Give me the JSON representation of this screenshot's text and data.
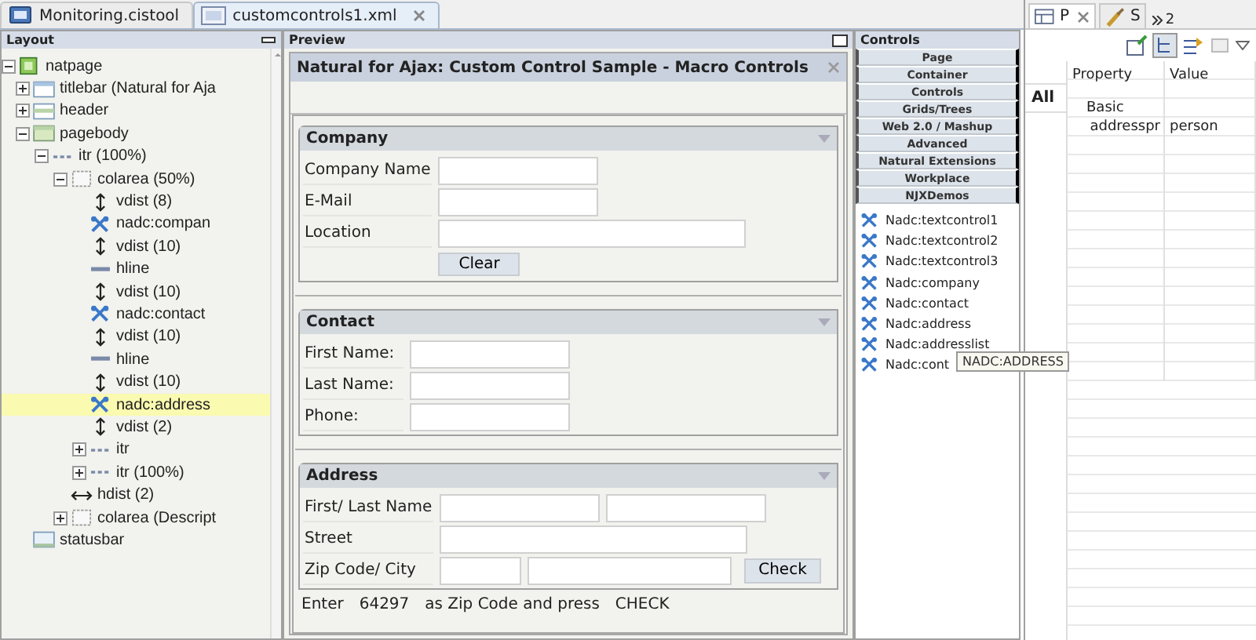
{
  "editor_tabs": [
    {
      "label": "Monitoring.cistool",
      "kind": "monitor",
      "selected": false,
      "closable": false
    },
    {
      "label": "customcontrols1.xml",
      "kind": "xml",
      "selected": true,
      "closable": true
    }
  ],
  "layout": {
    "title": "Layout",
    "tree": [
      {
        "label": "natpage",
        "kind": "page",
        "expanded": true,
        "selected": false,
        "children": [
          {
            "label": "titlebar (Natural for Aja",
            "kind": "window",
            "expanded": false,
            "selected": false
          },
          {
            "label": "header",
            "kind": "panel",
            "expanded": false,
            "selected": false
          },
          {
            "label": "pagebody",
            "kind": "body",
            "expanded": true,
            "selected": false,
            "children": [
              {
                "label": "itr (100%)",
                "kind": "row",
                "expanded": true,
                "selected": false,
                "children": [
                  {
                    "label": "colarea (50%)",
                    "kind": "area",
                    "expanded": true,
                    "selected": false,
                    "children": [
                      {
                        "label": "vdist (8)",
                        "kind": "vdist",
                        "selected": false
                      },
                      {
                        "label": "nadc:compan",
                        "kind": "tools",
                        "selected": false
                      },
                      {
                        "label": "vdist (10)",
                        "kind": "vdist",
                        "selected": false
                      },
                      {
                        "label": "hline",
                        "kind": "hline",
                        "selected": false
                      },
                      {
                        "label": "vdist (10)",
                        "kind": "vdist",
                        "selected": false
                      },
                      {
                        "label": "nadc:contact",
                        "kind": "tools",
                        "selected": false
                      },
                      {
                        "label": "vdist (10)",
                        "kind": "vdist",
                        "selected": false
                      },
                      {
                        "label": "hline",
                        "kind": "hline",
                        "selected": false
                      },
                      {
                        "label": "vdist (10)",
                        "kind": "vdist",
                        "selected": false
                      },
                      {
                        "label": "nadc:address",
                        "kind": "tools",
                        "selected": true
                      },
                      {
                        "label": "vdist (2)",
                        "kind": "vdist",
                        "selected": false
                      },
                      {
                        "label": "itr",
                        "kind": "row",
                        "expanded": false,
                        "selected": false
                      },
                      {
                        "label": "itr (100%)",
                        "kind": "row",
                        "expanded": false,
                        "selected": false
                      }
                    ]
                  },
                  {
                    "label": "hdist (2)",
                    "kind": "hdist",
                    "selected": false
                  },
                  {
                    "label": "colarea (Descript",
                    "kind": "area",
                    "expanded": false,
                    "selected": false
                  }
                ]
              }
            ]
          },
          {
            "label": "statusbar",
            "kind": "status",
            "selected": false
          }
        ]
      }
    ]
  },
  "preview": {
    "title": "Preview",
    "window_title": "Natural for Ajax: Custom Control Sample - Macro Controls",
    "sections": [
      {
        "title": "Company",
        "rows": [
          {
            "label": "Company Name",
            "fields": [
              {
                "kind": "medium"
              }
            ]
          },
          {
            "label": "E-Mail",
            "fields": [
              {
                "kind": "medium"
              }
            ]
          },
          {
            "label": "Location",
            "fields": [
              {
                "kind": "wide"
              }
            ]
          },
          {
            "fields": [],
            "button": "Clear"
          }
        ]
      },
      {
        "title": "Contact",
        "rows": [
          {
            "label": "First Name:",
            "fields": [
              {
                "kind": "medium"
              }
            ]
          },
          {
            "label": "Last Name:",
            "fields": [
              {
                "kind": "medium"
              }
            ]
          },
          {
            "label": "Phone:",
            "fields": [
              {
                "kind": "medium"
              }
            ]
          }
        ]
      },
      {
        "title": "Address",
        "rows": [
          {
            "label": "First/ Last Name",
            "fields": [
              {
                "kind": "medium"
              },
              {
                "kind": "medium"
              }
            ]
          },
          {
            "label": "Street",
            "fields": [
              {
                "kind": "wide"
              }
            ]
          },
          {
            "label": "Zip Code/ City",
            "fields": [
              {
                "kind": "short"
              },
              {
                "kind": "long"
              }
            ],
            "button": "Check"
          }
        ]
      }
    ],
    "hint": [
      "Enter",
      "64297",
      "as Zip Code and press",
      "CHECK"
    ]
  },
  "controls": {
    "title": "Controls",
    "categories": [
      "Page",
      "Container",
      "Controls",
      "Grids/Trees",
      "Web 2.0 / Mashup",
      "Advanced",
      "Natural Extensions",
      "Workplace",
      "NJXDemos"
    ],
    "items": [
      "Nadc:textcontrol1",
      "Nadc:textcontrol2",
      "Nadc:textcontrol3",
      "Nadc:company",
      "Nadc:contact",
      "Nadc:address",
      "Nadc:addresslist",
      "Nadc:cont"
    ],
    "tooltip": "NADC:ADDRESS"
  },
  "properties": {
    "tabs": [
      {
        "label": "P",
        "kind": "table",
        "selected": true,
        "closable": true
      },
      {
        "label": "S",
        "kind": "brush",
        "selected": false,
        "closable": false
      }
    ],
    "overflow": "2",
    "filter_tab": "All",
    "columns": [
      "Property",
      "Value"
    ],
    "rows": [
      {
        "kind": "category",
        "property": "Basic"
      },
      {
        "kind": "entry",
        "property": "addresspr",
        "value": "person"
      }
    ]
  }
}
